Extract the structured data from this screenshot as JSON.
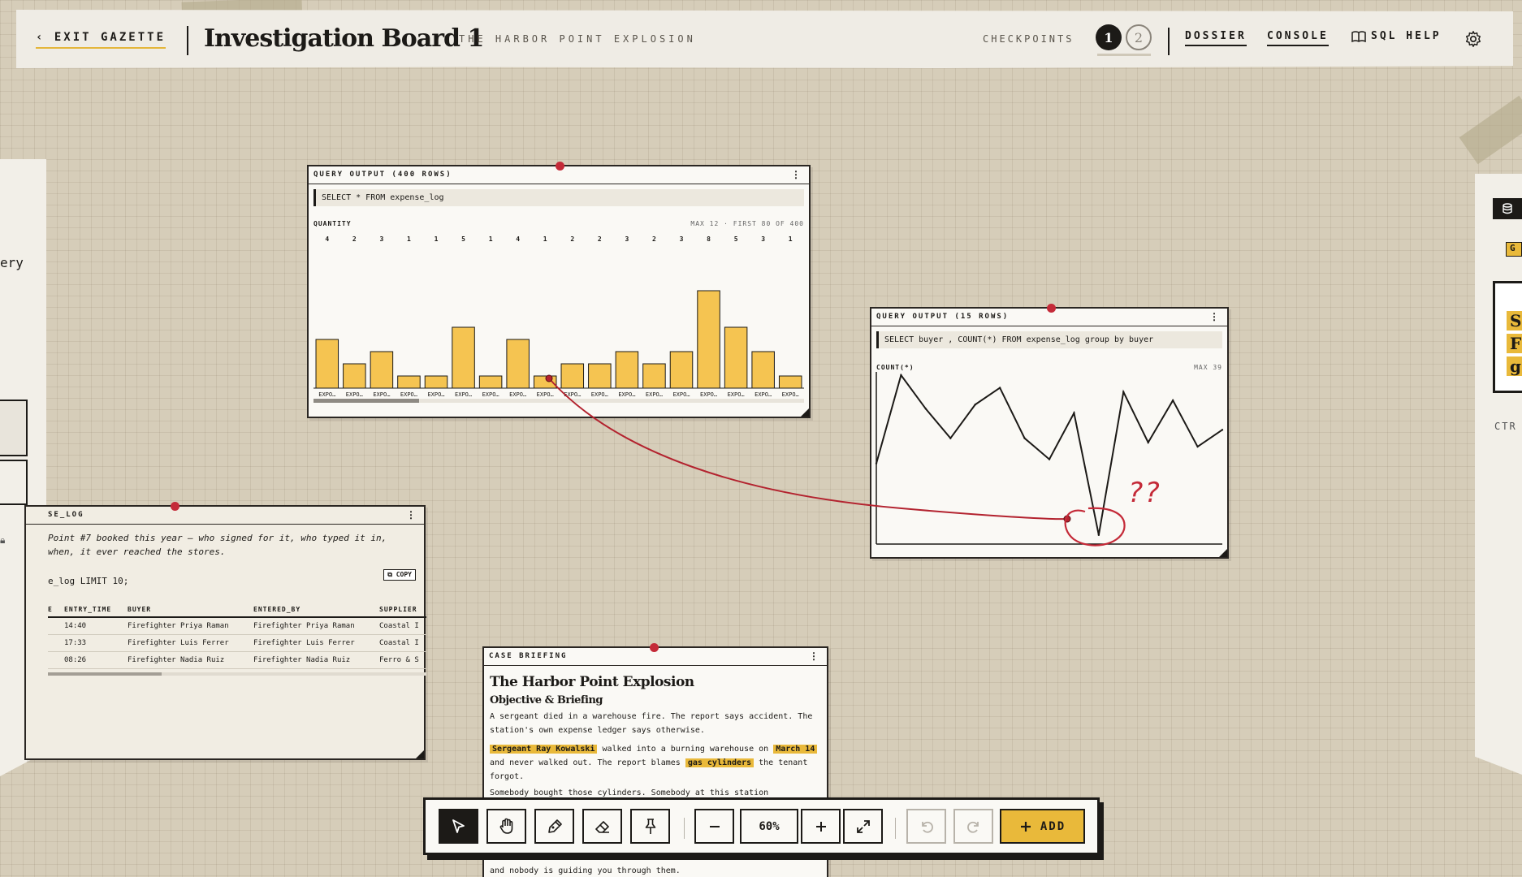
{
  "header": {
    "exit_label": "‹ EXIT GAZETTE",
    "title": "Investigation Board 1",
    "subtitle": "THE HARBOR POINT EXPLOSION",
    "checkpoints_label": "CHECKPOINTS",
    "checkpoints": [
      "1",
      "2"
    ],
    "links": {
      "dossier": "DOSSIER",
      "console": "CONSOLE",
      "sql_help": "SQL HELP"
    },
    "icons": {
      "sql_help": "book-icon",
      "settings": "gear-icon"
    }
  },
  "left_panel": {
    "text": "ery"
  },
  "right_panel": {
    "tag": "G",
    "highlights": [
      "S",
      "F",
      "g"
    ],
    "hint": "CTR"
  },
  "cards": {
    "expense_chart": {
      "header": "QUERY OUTPUT (400 ROWS)",
      "sql": "SELECT * FROM expense_log",
      "metric": "QUANTITY",
      "meta": "MAX 12 · FIRST 80 OF 400"
    },
    "buyer_chart": {
      "header": "QUERY OUTPUT (15 ROWS)",
      "sql": "SELECT buyer , COUNT(*) FROM expense_log group by buyer",
      "metric": "COUNT(*)",
      "meta": "MAX 39"
    },
    "expense_table": {
      "header": "SE_LOG",
      "desc": "Point #7 booked this year — who signed for it, who typed it in, when, it ever reached the stores.",
      "copy_label": "COPY",
      "sql": "e_log LIMIT 10;",
      "columns": [
        "E",
        "ENTRY_TIME",
        "BUYER",
        "ENTERED_BY",
        "SUPPLIER"
      ],
      "rows": [
        [
          "",
          "14:40",
          "Firefighter Priya Raman",
          "Firefighter Priya Raman",
          "Coastal I"
        ],
        [
          "",
          "17:33",
          "Firefighter Luis Ferrer",
          "Firefighter Luis Ferrer",
          "Coastal I"
        ],
        [
          "",
          "08:26",
          "Firefighter Nadia Ruiz",
          "Firefighter Nadia Ruiz",
          "Ferro & S"
        ]
      ]
    },
    "briefing": {
      "header": "CASE BRIEFING",
      "title": "The Harbor Point Explosion",
      "subtitle": "Objective & Briefing",
      "p1": "A sergeant died in a warehouse fire. The report says accident. The station's own expense ledger says otherwise.",
      "p2_hl1": "Sergeant Ray Kowalski",
      "p2_t1": " walked into a burning warehouse on ",
      "p2_hl2": "March 14",
      "p2_t2": " and never walked out. The report blames ",
      "p2_hl3": "gas cylinders",
      "p2_t3": " the tenant forgot.",
      "p3": "Somebody bought those cylinders. Somebody at this station",
      "p4": "and nobody is guiding you through them."
    }
  },
  "annotation": {
    "note": "??"
  },
  "toolbar": {
    "tools": [
      "select-icon",
      "hand-icon",
      "pen-icon",
      "eraser-icon",
      "pin-icon"
    ],
    "zoom": "60%",
    "add_label": "ADD"
  },
  "chart_data": [
    {
      "type": "bar",
      "title": "QUANTITY",
      "categories": [
        "EXPO…",
        "EXPO…",
        "EXPO…",
        "EXPO…",
        "EXPO…",
        "EXPO…",
        "EXPO…",
        "EXPO…",
        "EXPO…",
        "EXPO…",
        "EXPO…",
        "EXPO…",
        "EXPO…",
        "EXPO…",
        "EXPO…",
        "EXPO…",
        "EXPO…",
        "EXPO…"
      ],
      "values": [
        4,
        2,
        3,
        1,
        1,
        5,
        1,
        4,
        1,
        2,
        2,
        3,
        2,
        3,
        8,
        5,
        3,
        1
      ],
      "ylim": [
        0,
        12
      ],
      "color": "#f5c451"
    },
    {
      "type": "line",
      "title": "COUNT(*)",
      "x": [
        1,
        2,
        3,
        4,
        5,
        6,
        7,
        8,
        9,
        10,
        11,
        12,
        13,
        14,
        15
      ],
      "values": [
        18,
        39,
        31,
        24,
        32,
        36,
        24,
        19,
        30,
        1,
        35,
        23,
        33,
        22,
        26
      ],
      "ylim": [
        0,
        39
      ]
    }
  ]
}
